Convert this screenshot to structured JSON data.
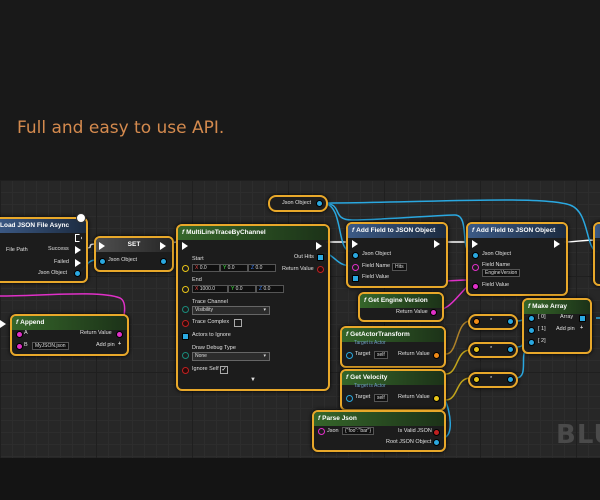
{
  "tagline": "Full and easy to use API.",
  "watermark": "BLU",
  "nodes": {
    "load": {
      "title": "Load JSON File Async",
      "file_path": "File Path",
      "success": "Success",
      "failed": "Failed",
      "json_object": "Json Object"
    },
    "set": {
      "title": "SET",
      "json_object": "Json Object"
    },
    "append": {
      "title": "Append",
      "a": "A",
      "b": "B",
      "b_value": "MyJSON.json",
      "return_value": "Return Value",
      "add_pin": "Add pin"
    },
    "trace": {
      "title": "MultiLineTraceByChannel",
      "start": "Start",
      "start_x": "0.0",
      "start_y": "0.0",
      "start_z": "0.0",
      "end": "End",
      "end_x": "1000.0",
      "end_y": "0.0",
      "end_z": "0.0",
      "trace_channel": "Trace Channel",
      "trace_channel_value": "Visibility",
      "trace_complex": "Trace Complex",
      "actors_to_ignore": "Actors to Ignore",
      "draw_debug_type": "Draw Debug Type",
      "draw_debug_value": "None",
      "ignore_self": "Ignore Self",
      "out_hits": "Out Hits",
      "return_value": "Return Value"
    },
    "json_var": {
      "label": "Json Object"
    },
    "add1": {
      "title": "Add Field to JSON Object",
      "json_object": "Json Object",
      "field_name": "Field Name",
      "field_name_value": "Hits",
      "field_value": "Field Value"
    },
    "add2": {
      "title": "Add Field to JSON Object",
      "json_object": "Json Object",
      "field_name": "Field Name",
      "field_name_value": "EngineVersion",
      "field_value": "Field Value"
    },
    "engine": {
      "title": "Get Engine Version",
      "return_value": "Return Value"
    },
    "transform": {
      "title": "GetActorTransform",
      "subtitle": "Target is Actor",
      "target": "Target",
      "target_value": "self",
      "return_value": "Return Value"
    },
    "velocity": {
      "title": "Get Velocity",
      "subtitle": "Target is Actor",
      "target": "Target",
      "target_value": "self",
      "return_value": "Return Value"
    },
    "parse": {
      "title": "Parse Json",
      "json": "Json",
      "json_value": "{\"foo\":\"bar\"}",
      "is_valid": "Is Valid JSON",
      "root": "Root JSON Object"
    },
    "make_array": {
      "title": "Make Array",
      "i0": "[ 0]",
      "i1": "[ 1]",
      "i2": "[ 2]",
      "array": "Array",
      "add_pin": "Add pin"
    },
    "conv": [
      "*",
      "*",
      "*"
    ]
  }
}
